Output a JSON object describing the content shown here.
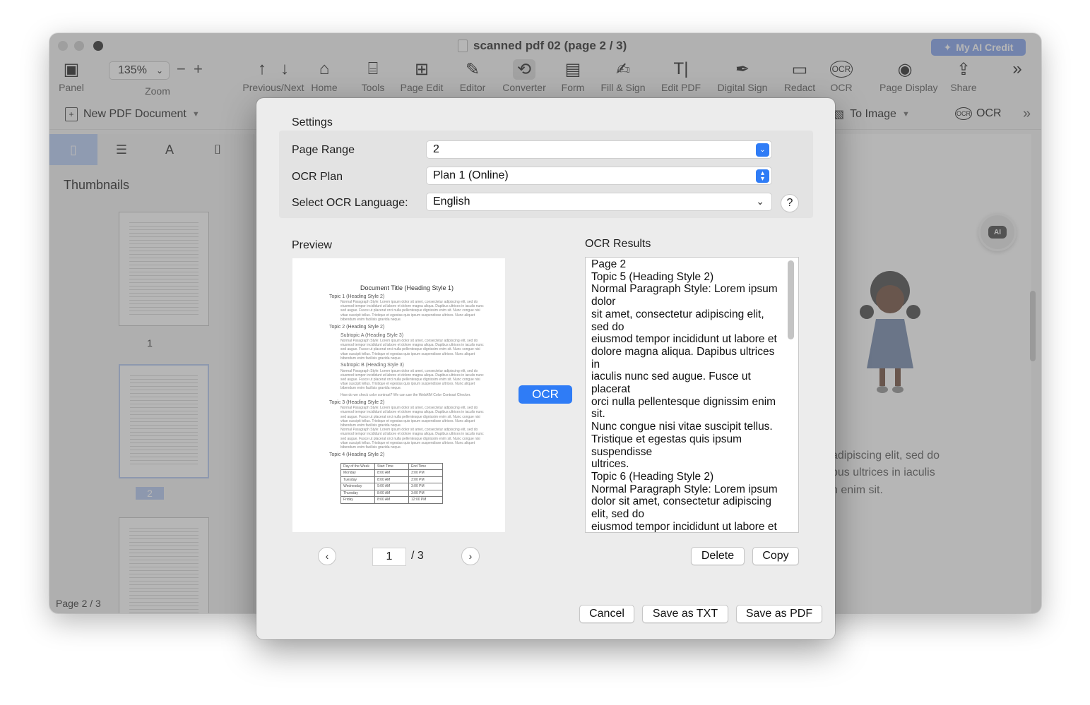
{
  "window": {
    "title": "scanned pdf 02 (page 2 / 3)",
    "ai_credit": "My AI Credit"
  },
  "toolbar": {
    "zoom_value": "135%",
    "items": [
      {
        "label": "Panel",
        "icon": "panel-icon"
      },
      {
        "label": "Zoom",
        "icon": "zoom-icon"
      },
      {
        "label": "Previous/Next",
        "icon": "arrow-up-down-icon"
      },
      {
        "label": "Home",
        "icon": "home-icon"
      },
      {
        "label": "Tools",
        "icon": "toolbox-icon"
      },
      {
        "label": "Page Edit",
        "icon": "grid-icon"
      },
      {
        "label": "Editor",
        "icon": "edit-icon"
      },
      {
        "label": "Converter",
        "icon": "convert-icon"
      },
      {
        "label": "Form",
        "icon": "form-icon"
      },
      {
        "label": "Fill & Sign",
        "icon": "fill-sign-icon"
      },
      {
        "label": "Edit PDF",
        "icon": "text-edit-icon"
      },
      {
        "label": "Digital Sign",
        "icon": "pen-icon"
      },
      {
        "label": "Redact",
        "icon": "redact-icon"
      },
      {
        "label": "OCR",
        "icon": "ocr-icon"
      },
      {
        "label": "Page Display",
        "icon": "eye-icon"
      },
      {
        "label": "Share",
        "icon": "share-icon"
      }
    ]
  },
  "subbar": {
    "new_pdf": "New PDF Document",
    "to_image": "To Image",
    "ocr": "OCR"
  },
  "sidebar": {
    "title": "Thumbnails",
    "thumbs": [
      {
        "num": "1"
      },
      {
        "num": "2"
      }
    ],
    "page_count": "Page 2 / 3"
  },
  "page_bg_text": {
    "line1": "adipiscing elit, sed do",
    "line2": "bus ultrices in iaculis",
    "line3": "n enim sit."
  },
  "dialog": {
    "settings_title": "Settings",
    "page_range_label": "Page Range",
    "page_range_value": "2",
    "ocr_plan_label": "OCR Plan",
    "ocr_plan_value": "Plan 1 (Online)",
    "language_label": "Select OCR Language:",
    "language_value": "English",
    "help": "?",
    "preview_title": "Preview",
    "results_title": "OCR Results",
    "ocr_button": "OCR",
    "results_text": "Page 2\nTopic 5 (Heading Style 2)\nNormal Paragraph Style: Lorem ipsum\ndolor\nsit amet, consectetur adipiscing elit,\nsed do\neiusmod tempor incididunt ut labore et\ndolore magna aliqua. Dapibus ultrices\nin\niaculis nunc sed augue. Fusce ut\nplacerat\norci nulla pellentesque dignissim enim\nsit.\nNunc congue nisi vitae suscipit tellus.\nTristique et egestas quis ipsum\nsuspendisse\nultrices.\nTopic 6 (Heading Style 2)\nNormal Paragraph Style: Lorem ipsum\ndolor sit amet, consectetur adipiscing\nelit, sed do\neiusmod tempor incididunt ut labore et",
    "page_input": "1",
    "page_total": "/ 3",
    "delete": "Delete",
    "copy": "Copy",
    "cancel": "Cancel",
    "save_txt": "Save as TXT",
    "save_pdf": "Save as PDF",
    "preview_doc": {
      "title": "Document Title (Heading Style 1)",
      "topic1": "Topic 1 (Heading Style 2)",
      "para1": "Normal Paragraph Style: Lorem ipsum dolor sit amet, consectetur adipiscing elit, sed do eiusmod tempor incididunt ut labore et dolore magna aliqua. Dapibus ultrices in iaculis nunc sed augue. Fusce ut placerat orci nulla pellentesque dignissim enim sit. Nunc congue nisi vitae suscipit tellus. Tristique et egestas quis ipsum suspendisse ultrices. Nunc aliquet bibendum enim facilisis gravida neque.",
      "topic2": "Topic 2 (Heading Style 2)",
      "subA": "Subtopic A (Heading Style 3)",
      "subB": "Subtopic B (Heading Style 3)",
      "contrast": "How do we check color contrast? We can use the WebAIM Color Contrast Checker.",
      "topic3": "Topic 3 (Heading Style 2)",
      "topic4": "Topic 4 (Heading Style 2)",
      "table_header": [
        "Day of the Week",
        "Start Time",
        "End Time"
      ],
      "table_rows": [
        [
          "Monday",
          "8:00 AM",
          "3:00 PM"
        ],
        [
          "Tuesday",
          "8:00 AM",
          "3:00 PM"
        ],
        [
          "Wednesday",
          "9:00 AM",
          "3:00 PM"
        ],
        [
          "Thursday",
          "8:00 AM",
          "3:00 PM"
        ],
        [
          "Friday",
          "8:00 AM",
          "12:00 PM"
        ]
      ]
    }
  }
}
